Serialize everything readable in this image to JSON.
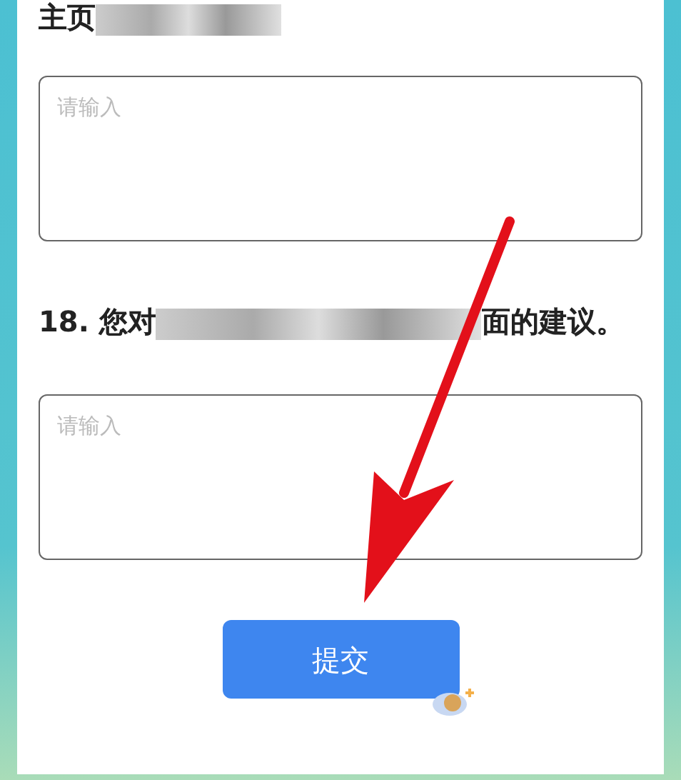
{
  "questions": [
    {
      "title": [
        {
          "kind": "text",
          "text": "主页"
        },
        {
          "kind": "redacted"
        }
      ],
      "placeholder": "请输入"
    },
    {
      "title": [
        {
          "kind": "text",
          "text": "18. 您对"
        },
        {
          "kind": "redacted"
        },
        {
          "kind": "text",
          "text": "面的建议。"
        }
      ],
      "placeholder": "请输入"
    }
  ],
  "submit_button": "提交"
}
